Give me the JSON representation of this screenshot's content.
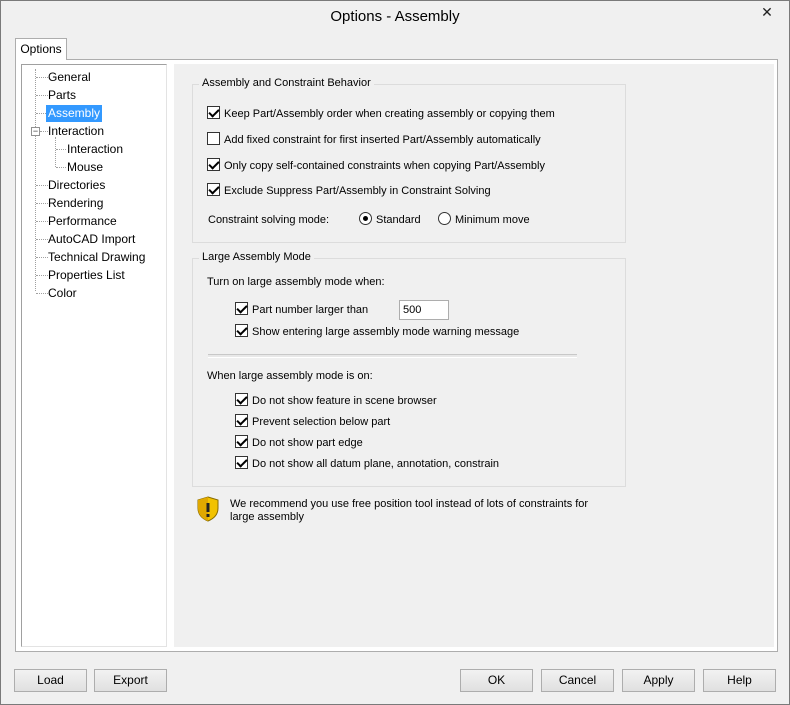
{
  "window": {
    "title": "Options - Assembly",
    "close_glyph": "✕"
  },
  "tab": {
    "label": "Options"
  },
  "tree": {
    "items": [
      {
        "label": "General"
      },
      {
        "label": "Parts"
      },
      {
        "label": "Assembly"
      },
      {
        "label": "Interaction"
      },
      {
        "label": "Interaction"
      },
      {
        "label": "Mouse"
      },
      {
        "label": "Directories"
      },
      {
        "label": "Rendering"
      },
      {
        "label": "Performance"
      },
      {
        "label": "AutoCAD Import"
      },
      {
        "label": "Technical Drawing"
      },
      {
        "label": "Properties List"
      },
      {
        "label": "Color"
      }
    ],
    "selected": "Assembly",
    "expander_glyph": "−"
  },
  "behavior": {
    "title": "Assembly and Constraint Behavior",
    "options": [
      {
        "label": "Keep Part/Assembly order when creating assembly or copying them",
        "checked": true
      },
      {
        "label": "Add fixed constraint for first inserted Part/Assembly automatically",
        "checked": false
      },
      {
        "label": "Only copy self-contained constraints when copying Part/Assembly",
        "checked": true
      },
      {
        "label": "Exclude Suppress Part/Assembly in Constraint Solving",
        "checked": true
      }
    ],
    "solving_mode_label": "Constraint solving mode:",
    "solving_modes": [
      {
        "label": "Standard",
        "selected": true
      },
      {
        "label": "Minimum move",
        "selected": false
      }
    ]
  },
  "large_mode": {
    "title": "Large Assembly Mode",
    "turn_on_label": "Turn on large assembly mode when:",
    "part_number_label": "Part number larger than",
    "part_number_checked": true,
    "part_number_value": "500",
    "warning_label": "Show entering large assembly mode warning message",
    "warning_checked": true,
    "when_on_label": "When large assembly mode is on:",
    "when_on_options": [
      {
        "label": "Do not show feature in scene browser",
        "checked": true
      },
      {
        "label": "Prevent selection below part",
        "checked": true
      },
      {
        "label": "Do not show part edge",
        "checked": true
      },
      {
        "label": "Do not show all datum plane, annotation, constrain",
        "checked": true
      }
    ]
  },
  "tip": {
    "icon": "shield-warning-icon",
    "text": "We recommend you use free position tool instead of lots of constraints for large assembly"
  },
  "buttons": {
    "load": "Load",
    "export": "Export",
    "ok": "OK",
    "cancel": "Cancel",
    "apply": "Apply",
    "help": "Help"
  },
  "colors": {
    "selection": "#3399ff",
    "window_bg": "#f0f0f0",
    "shield_yellow": "#f2c200"
  }
}
